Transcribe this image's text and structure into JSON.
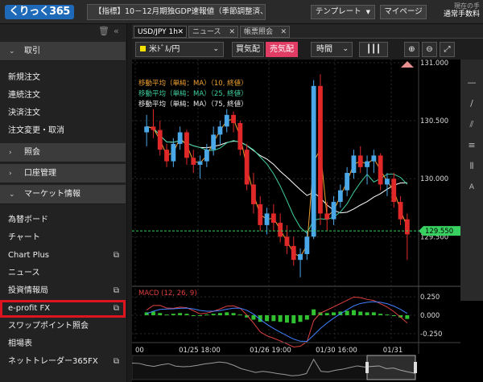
{
  "topbar": {
    "logo": "くりっく365",
    "news": "【指標】10－12月期独GDP速報値（季節調整済、…",
    "template_label": "テンプレート",
    "mypage_label": "マイページ",
    "current_label": "現在の手",
    "mode_label": "通常手数料"
  },
  "sidebar": {
    "sections": {
      "trade": "取引",
      "inquiry": "照会",
      "account": "口座管理",
      "market": "マーケット情報"
    },
    "trade_items": [
      "新規注文",
      "連続注文",
      "決済注文",
      "注文変更・取消"
    ],
    "market_items": [
      {
        "label": "為替ボード",
        "external": false
      },
      {
        "label": "チャート",
        "external": false
      },
      {
        "label": "Chart Plus",
        "external": true
      },
      {
        "label": "ニュース",
        "external": false
      },
      {
        "label": "投資情報局",
        "external": true
      },
      {
        "label": "e-profit FX",
        "external": true,
        "highlighted": true
      },
      {
        "label": "スワップポイント照会",
        "external": false
      },
      {
        "label": "相場表",
        "external": false
      },
      {
        "label": "ネットトレーダー365FX",
        "external": true
      }
    ]
  },
  "tabs": [
    {
      "label": "USD/JPY 1h",
      "active": true
    },
    {
      "label": "ニュース",
      "active": false
    },
    {
      "label": "帳票照会",
      "active": false
    }
  ],
  "toolbar": {
    "symbol": "米ﾄﾞﾙ/円",
    "bid_label": "買気配",
    "ask_label": "売気配",
    "interval_label": "時間"
  },
  "indicators": {
    "ma1": "移動平均（単純：MA）（10, 終値）",
    "ma2": "移動平均（単純：MA）（25, 終値）",
    "ma3": "移動平均（単純：MA）（75, 終値）",
    "macd": "MACD (12, 26, 9)"
  },
  "colors": {
    "ma10": "#f0a030",
    "ma25": "#40d0a0",
    "ma75": "#ffffff",
    "up": "#4aa8e8",
    "down": "#e02828",
    "macd_line": "#e04040",
    "signal_line": "#4080ff",
    "hist": "#30c030",
    "price_tag": "#38d060",
    "highlight": "#e0141e",
    "ask_bg": "#e03c64"
  },
  "chart_data": {
    "type": "candlestick",
    "title": "USD/JPY 1h",
    "price_axis": {
      "ticks": [
        "131.000",
        "130.500",
        "130.000",
        "129.500"
      ],
      "ylim": [
        129.1,
        131.0
      ]
    },
    "current_price": "129.550",
    "macd_axis": {
      "ticks": [
        "0.250",
        "0.000",
        "-0.250"
      ],
      "ylim": [
        -0.35,
        0.35
      ]
    },
    "x_ticks": [
      "00",
      "01/25 18:00",
      "01/26 19:00",
      "01/30 16:00",
      "01/31"
    ],
    "candles": [
      [
        130.4,
        130.55,
        130.28,
        130.45
      ],
      [
        130.45,
        130.6,
        130.35,
        130.42
      ],
      [
        130.42,
        130.5,
        130.2,
        130.25
      ],
      [
        130.25,
        130.3,
        130.1,
        130.15
      ],
      [
        130.15,
        130.35,
        130.1,
        130.3
      ],
      [
        130.3,
        130.45,
        130.25,
        130.4
      ],
      [
        130.4,
        130.42,
        130.12,
        130.18
      ],
      [
        130.18,
        130.25,
        130.05,
        130.12
      ],
      [
        130.12,
        130.2,
        130.0,
        130.15
      ],
      [
        130.15,
        130.3,
        130.1,
        130.25
      ],
      [
        130.25,
        130.45,
        130.2,
        130.38
      ],
      [
        130.38,
        130.5,
        130.3,
        130.45
      ],
      [
        130.45,
        130.6,
        130.4,
        130.55
      ],
      [
        130.55,
        130.58,
        130.4,
        130.48
      ],
      [
        130.48,
        130.5,
        130.2,
        130.25
      ],
      [
        130.25,
        130.3,
        129.9,
        129.95
      ],
      [
        129.95,
        130.05,
        129.7,
        129.78
      ],
      [
        129.78,
        129.85,
        129.55,
        129.6
      ],
      [
        129.6,
        129.75,
        129.52,
        129.7
      ],
      [
        129.7,
        129.78,
        129.55,
        129.62
      ],
      [
        129.62,
        129.7,
        129.45,
        129.5
      ],
      [
        129.5,
        129.6,
        129.35,
        129.42
      ],
      [
        129.42,
        129.5,
        129.25,
        129.3
      ],
      [
        129.3,
        129.4,
        129.15,
        129.35
      ],
      [
        129.35,
        129.55,
        129.3,
        129.5
      ],
      [
        129.5,
        130.85,
        129.48,
        130.8
      ],
      [
        130.8,
        130.9,
        129.6,
        129.7
      ],
      [
        129.7,
        129.8,
        129.55,
        129.65
      ],
      [
        129.65,
        129.85,
        129.6,
        129.8
      ],
      [
        129.8,
        129.95,
        129.75,
        129.9
      ],
      [
        129.9,
        130.1,
        129.85,
        130.05
      ],
      [
        130.05,
        130.25,
        130.0,
        130.2
      ],
      [
        130.2,
        130.28,
        130.05,
        130.1
      ],
      [
        130.1,
        130.2,
        129.95,
        130.15
      ],
      [
        130.15,
        130.25,
        130.05,
        130.2
      ],
      [
        130.2,
        130.22,
        129.9,
        129.95
      ],
      [
        129.95,
        130.05,
        129.85,
        130.0
      ],
      [
        130.0,
        130.05,
        129.75,
        129.8
      ],
      [
        129.8,
        129.85,
        129.6,
        129.65
      ],
      [
        129.65,
        129.7,
        129.3,
        129.52
      ]
    ],
    "macd_hist": [
      0.04,
      0.05,
      0.03,
      0.01,
      0.02,
      0.03,
      0.02,
      0.0,
      -0.01,
      0.01,
      0.02,
      0.03,
      0.04,
      0.03,
      0.01,
      -0.03,
      -0.06,
      -0.09,
      -0.08,
      -0.08,
      -0.09,
      -0.1,
      -0.11,
      -0.09,
      -0.06,
      0.08,
      0.04,
      0.03,
      0.04,
      0.05,
      0.06,
      0.07,
      0.05,
      0.04,
      0.04,
      0.02,
      0.01,
      -0.01,
      -0.03,
      -0.05
    ]
  }
}
